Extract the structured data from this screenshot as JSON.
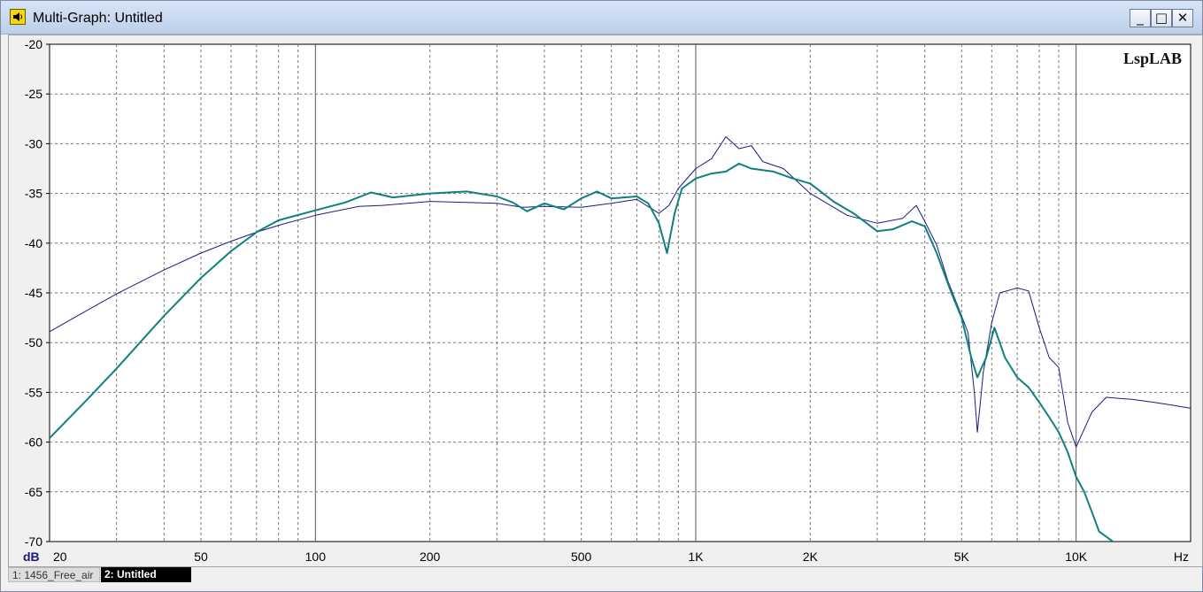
{
  "window": {
    "title": "Multi-Graph: Untitled"
  },
  "controls": {
    "minimize": "_",
    "maximize": "□",
    "close": "✕"
  },
  "brand": "LspLAB",
  "chart_data": {
    "type": "line",
    "xscale": "log",
    "xlim": [
      20,
      20000
    ],
    "ylim": [
      -70,
      -20
    ],
    "ylabel": "dB",
    "xlabel": "Hz",
    "x_ticks": [
      {
        "v": 20,
        "label": "20"
      },
      {
        "v": 50,
        "label": "50"
      },
      {
        "v": 100,
        "label": "100"
      },
      {
        "v": 200,
        "label": "200"
      },
      {
        "v": 500,
        "label": "500"
      },
      {
        "v": 1000,
        "label": "1K"
      },
      {
        "v": 2000,
        "label": "2K"
      },
      {
        "v": 5000,
        "label": "5K"
      },
      {
        "v": 10000,
        "label": "10K"
      }
    ],
    "y_ticks": [
      -20,
      -25,
      -30,
      -35,
      -40,
      -45,
      -50,
      -55,
      -60,
      -65,
      -70
    ],
    "grid": true,
    "series": [
      {
        "name": "1: 1456_Free_air",
        "color": "#1a1a80",
        "points": [
          [
            20,
            -48.9
          ],
          [
            25,
            -46.8
          ],
          [
            30,
            -45.1
          ],
          [
            40,
            -42.7
          ],
          [
            50,
            -41.0
          ],
          [
            60,
            -39.8
          ],
          [
            70,
            -38.9
          ],
          [
            80,
            -38.2
          ],
          [
            100,
            -37.2
          ],
          [
            130,
            -36.3
          ],
          [
            150,
            -36.2
          ],
          [
            200,
            -35.8
          ],
          [
            250,
            -35.9
          ],
          [
            300,
            -36.0
          ],
          [
            350,
            -36.4
          ],
          [
            400,
            -36.3
          ],
          [
            500,
            -36.4
          ],
          [
            600,
            -36.0
          ],
          [
            700,
            -35.6
          ],
          [
            800,
            -37.0
          ],
          [
            850,
            -36.2
          ],
          [
            900,
            -34.5
          ],
          [
            1000,
            -32.5
          ],
          [
            1100,
            -31.5
          ],
          [
            1200,
            -29.3
          ],
          [
            1300,
            -30.5
          ],
          [
            1400,
            -30.2
          ],
          [
            1500,
            -31.8
          ],
          [
            1700,
            -32.5
          ],
          [
            2000,
            -35.0
          ],
          [
            2500,
            -37.2
          ],
          [
            3000,
            -38.0
          ],
          [
            3500,
            -37.5
          ],
          [
            3800,
            -36.2
          ],
          [
            4000,
            -37.8
          ],
          [
            4300,
            -40.2
          ],
          [
            4600,
            -43.8
          ],
          [
            5000,
            -47.3
          ],
          [
            5200,
            -49.0
          ],
          [
            5400,
            -55.0
          ],
          [
            5500,
            -59.0
          ],
          [
            5700,
            -53.0
          ],
          [
            6000,
            -48.0
          ],
          [
            6300,
            -45.0
          ],
          [
            7000,
            -44.5
          ],
          [
            7500,
            -44.8
          ],
          [
            8000,
            -48.5
          ],
          [
            8500,
            -51.5
          ],
          [
            9000,
            -52.5
          ],
          [
            9500,
            -58.0
          ],
          [
            10000,
            -60.5
          ],
          [
            11000,
            -57.0
          ],
          [
            12000,
            -55.5
          ],
          [
            14000,
            -55.7
          ],
          [
            16000,
            -56.0
          ],
          [
            18000,
            -56.3
          ],
          [
            20000,
            -56.6
          ]
        ]
      },
      {
        "name": "2: Untitled",
        "color": "#0f8080",
        "points": [
          [
            20,
            -59.6
          ],
          [
            25,
            -55.8
          ],
          [
            30,
            -52.6
          ],
          [
            40,
            -47.3
          ],
          [
            50,
            -43.5
          ],
          [
            60,
            -40.8
          ],
          [
            70,
            -38.9
          ],
          [
            80,
            -37.7
          ],
          [
            100,
            -36.7
          ],
          [
            120,
            -35.9
          ],
          [
            140,
            -34.9
          ],
          [
            160,
            -35.4
          ],
          [
            200,
            -35.0
          ],
          [
            250,
            -34.8
          ],
          [
            300,
            -35.3
          ],
          [
            330,
            -35.9
          ],
          [
            360,
            -36.8
          ],
          [
            400,
            -36.0
          ],
          [
            450,
            -36.6
          ],
          [
            500,
            -35.5
          ],
          [
            550,
            -34.8
          ],
          [
            600,
            -35.5
          ],
          [
            700,
            -35.3
          ],
          [
            750,
            -36.0
          ],
          [
            800,
            -38.0
          ],
          [
            840,
            -41.0
          ],
          [
            880,
            -37.0
          ],
          [
            920,
            -34.5
          ],
          [
            1000,
            -33.5
          ],
          [
            1100,
            -33.0
          ],
          [
            1200,
            -32.8
          ],
          [
            1300,
            -32.0
          ],
          [
            1400,
            -32.5
          ],
          [
            1600,
            -32.8
          ],
          [
            1800,
            -33.5
          ],
          [
            2000,
            -34.0
          ],
          [
            2300,
            -35.8
          ],
          [
            2600,
            -37.0
          ],
          [
            3000,
            -38.8
          ],
          [
            3300,
            -38.6
          ],
          [
            3700,
            -37.8
          ],
          [
            4000,
            -38.3
          ],
          [
            4300,
            -41.0
          ],
          [
            4700,
            -45.0
          ],
          [
            5000,
            -47.5
          ],
          [
            5300,
            -51.5
          ],
          [
            5500,
            -53.5
          ],
          [
            5800,
            -51.5
          ],
          [
            6100,
            -48.5
          ],
          [
            6500,
            -51.5
          ],
          [
            7000,
            -53.5
          ],
          [
            7500,
            -54.5
          ],
          [
            8000,
            -56.0
          ],
          [
            8500,
            -57.5
          ],
          [
            9000,
            -59.0
          ],
          [
            9500,
            -61.0
          ],
          [
            10000,
            -63.5
          ],
          [
            10500,
            -65.0
          ],
          [
            11000,
            -67.0
          ],
          [
            11500,
            -69.0
          ],
          [
            12000,
            -69.5
          ],
          [
            12500,
            -70.0
          ]
        ]
      }
    ]
  }
}
